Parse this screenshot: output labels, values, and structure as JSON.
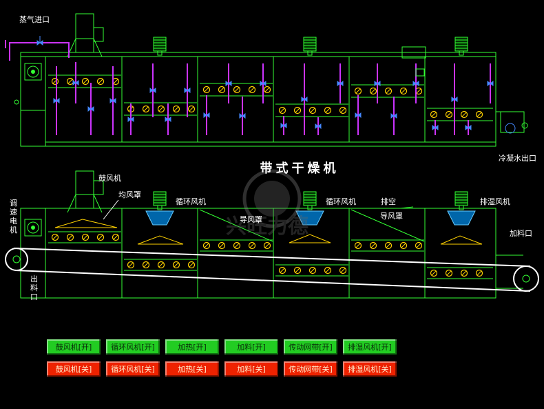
{
  "title": "带式干燥机",
  "labels": {
    "steam_inlet": "蒸气进口",
    "condensate_outlet": "冷凝水出口",
    "blower": "鼓风机",
    "even_air_hood": "均风罩",
    "circulation_fan_1": "循环风机",
    "circulation_fan_2": "循环风机",
    "exhaust_vent": "排空",
    "dehumidify_fan": "排湿风机",
    "guide_hood_1": "导风罩",
    "guide_hood_2": "导风罩",
    "feed_inlet": "加料口",
    "speed_motor_1": "调",
    "speed_motor_2": "速",
    "speed_motor_3": "电",
    "speed_motor_4": "机",
    "discharge_1": "出",
    "discharge_2": "料",
    "discharge_3": "口",
    "watermark": "兴旺力德"
  },
  "controls": {
    "on_row": [
      "鼓风机[开]",
      "循环风机[开]",
      "加热[开]",
      "加料[开]",
      "传动网带[开]",
      "排湿风机[开]"
    ],
    "off_row": [
      "鼓风机[关]",
      "循环风机[关]",
      "加热[关]",
      "加料[关]",
      "传动网带[关]",
      "排湿风机[关]"
    ]
  },
  "colors": {
    "frame": "#33ff33",
    "pipe": "#cc33ff",
    "valve": "#4488ff",
    "heater": "#ffd200",
    "belt": "#ffffff",
    "on": "#22cc22",
    "off": "#ee2200"
  }
}
